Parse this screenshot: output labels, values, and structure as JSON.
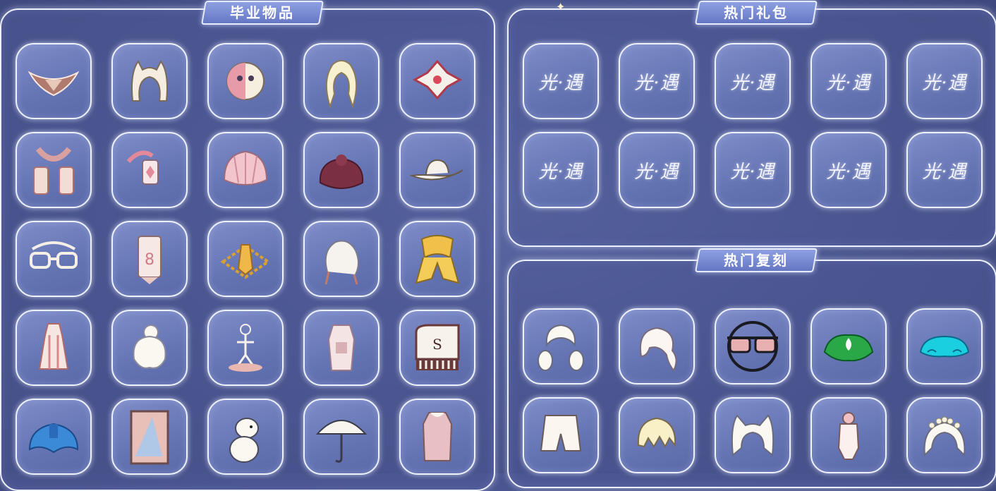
{
  "sections": {
    "graduation": {
      "title": "毕业物品"
    },
    "hot_gifts": {
      "title": "热门礼包"
    },
    "hot_reruns": {
      "title": "热门复刻"
    }
  },
  "gift_logo_text": "光·遇",
  "graduation_items": [
    "wing-cape-icon",
    "animal-ears-hair-icon",
    "half-mask-icon",
    "long-hair-icon",
    "jester-hat-icon",
    "scarf-cape-icon",
    "lantern-prop-icon",
    "shell-cape-icon",
    "maroon-cape-icon",
    "cowboy-hat-icon",
    "glasses-icon",
    "ticket-stand-prop-icon",
    "golden-rope-necklace-icon",
    "braided-hair-icon",
    "golden-bow-cape-icon",
    "dress-outfit-icon",
    "bun-hair-icon",
    "statue-prop-icon",
    "robe-outfit-icon",
    "piano-prop-icon",
    "blue-cape-icon",
    "painting-prop-icon",
    "moomin-prop-icon",
    "umbrella-prop-icon",
    "coat-outfit-icon"
  ],
  "rerun_items": [
    "twin-tail-hair-icon",
    "ponytail-hair-icon",
    "sunglasses-icon",
    "green-leaf-cape-icon",
    "cyan-cloud-cape-icon",
    "shorts-outfit-icon",
    "short-hair-icon",
    "cat-ear-hair-icon",
    "onesie-outfit-icon",
    "flower-crown-hair-icon"
  ]
}
